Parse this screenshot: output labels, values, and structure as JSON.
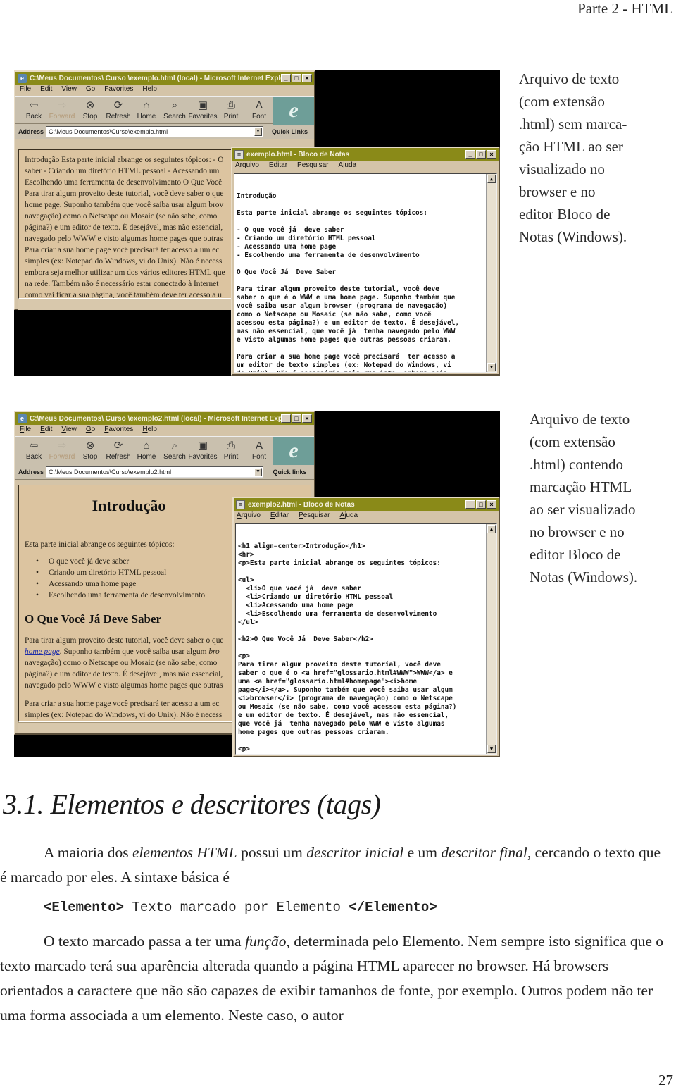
{
  "header": {
    "running_title": "Parte 2 - HTML"
  },
  "figure1": {
    "ie": {
      "title": "C:\\Meus Documentos\\ Curso \\exemplo.html (local) - Microsoft Internet Explorer",
      "menu": [
        "File",
        "Edit",
        "View",
        "Go",
        "Favorites",
        "Help"
      ],
      "toolbar": [
        {
          "label": "Back",
          "icon": "back-arrow-icon",
          "glyph": "⇦"
        },
        {
          "label": "Forward",
          "icon": "forward-arrow-icon",
          "glyph": "⇨"
        },
        {
          "label": "Stop",
          "icon": "stop-icon",
          "glyph": "⊗"
        },
        {
          "label": "Refresh",
          "icon": "refresh-icon",
          "glyph": "⟳"
        },
        {
          "label": "Home",
          "icon": "home-icon",
          "glyph": "⌂"
        },
        {
          "label": "Search",
          "icon": "search-icon",
          "glyph": "⌕"
        },
        {
          "label": "Favorites",
          "icon": "favorites-icon",
          "glyph": "▣"
        },
        {
          "label": "Print",
          "icon": "print-icon",
          "glyph": "⎙"
        },
        {
          "label": "Font",
          "icon": "font-icon",
          "glyph": "A"
        }
      ],
      "address_label": "Address",
      "address_value": "C:\\Meus Documentos\\Curso\\exemplo.html",
      "quick_links": "Quick Links",
      "content_lines": [
        "Introdução Esta parte inicial abrange os seguintes tópicos: - O",
        "saber - Criando um diretório HTML pessoal - Acessando um",
        "Escolhendo uma ferramenta de desenvolvimento O Que Você",
        "Para tirar algum proveito deste tutorial, você deve saber o que",
        "home page. Suponho também que você saiba usar algum brov",
        "navegação) como o Netscape ou Mosaic (se não sabe, como",
        "página?) e um editor de texto. É desejável, mas não essencial,",
        "navegado pelo WWW e visto algumas home pages que outras",
        "Para criar a sua home page você precisará  ter acesso a um ec",
        "simples (ex: Notepad do Windows, vi do Unix). Não é necess",
        "embora seja melhor utilizar um dos vários editores HTML que",
        "na rede. Também não é necessário estar conectado à Internet",
        "como vai ficar a sua página, você também deve ter acesso a u"
      ]
    },
    "notepad": {
      "title": "exemplo.html - Bloco de Notas",
      "menu": [
        "Arquivo",
        "Editar",
        "Pesquisar",
        "Ajuda"
      ],
      "text": "Introdução\n\nEsta parte inicial abrange os seguintes tópicos:\n\n- O que você já  deve saber\n- Criando um diretório HTML pessoal\n- Acessando uma home page\n- Escolhendo uma ferramenta de desenvolvimento\n\nO Que Você Já  Deve Saber\n\nPara tirar algum proveito deste tutorial, você deve\nsaber o que é o WWW e uma home page. Suponho também que\nvocê saiba usar algum browser (programa de navegação)\ncomo o Netscape ou Mosaic (se não sabe, como você\nacessou esta página?) e um editor de texto. É desejável,\nmas não essencial, que você já  tenha navegado pelo WWW\ne visto algumas home pages que outras pessoas criaram.\n\nPara criar a sua home page você precisará  ter acesso a\num editor de texto simples (ex: Notepad do Windows, vi\ndo Unix). Não é necessário mais que isto, embora seja\nmelhor utilizar um dos vários editores HTML que existem"
    },
    "caption": "Arquivo de texto\n(com extensão\n.html) sem marca-\nção HTML ao ser\nvisualizado no\nbrowser e no\neditor Bloco de\nNotas (Windows)."
  },
  "figure2": {
    "ie": {
      "title": "C:\\Meus Documentos\\ Curso \\exemplo2.html (local) - Microsoft Internet Explorer",
      "menu": [
        "File",
        "Edit",
        "View",
        "Go",
        "Favorites",
        "Help"
      ],
      "toolbar": [
        {
          "label": "Back",
          "icon": "back-arrow-icon",
          "glyph": "⇦"
        },
        {
          "label": "Forward",
          "icon": "forward-arrow-icon",
          "glyph": "⇨"
        },
        {
          "label": "Stop",
          "icon": "stop-icon",
          "glyph": "⊗"
        },
        {
          "label": "Refresh",
          "icon": "refresh-icon",
          "glyph": "⟳"
        },
        {
          "label": "Home",
          "icon": "home-icon",
          "glyph": "⌂"
        },
        {
          "label": "Search",
          "icon": "search-icon",
          "glyph": "⌕"
        },
        {
          "label": "Favorites",
          "icon": "favorites-icon",
          "glyph": "▣"
        },
        {
          "label": "Print",
          "icon": "print-icon",
          "glyph": "⎙"
        },
        {
          "label": "Font",
          "icon": "font-icon",
          "glyph": "A"
        }
      ],
      "address_label": "Address",
      "address_value": "C:\\Meus Documentos\\Curso\\exemplo2.html",
      "quick_links": "Quick links",
      "h1": "Introdução",
      "intro": "Esta parte inicial abrange os seguintes tópicos:",
      "list": [
        "O que você já  deve saber",
        "Criando um diretório HTML pessoal",
        "Acessando uma home page",
        "Escolhendo uma ferramenta de desenvolvimento"
      ],
      "h2": "O Que Você Já  Deve Saber",
      "p1_line1": "Para tirar algum proveito deste tutorial, você deve saber o que",
      "p1_link": "home page",
      "p1_line2_rest": ". Suponho também que você saiba usar algum ",
      "p1_line2_italic": "bro",
      "p1_rest": [
        "navegação) como o Netscape ou Mosaic (se não sabe, como",
        "página?) e um editor de texto. É desejável, mas não essencial,",
        "navegado pelo WWW e visto algumas home pages que outras"
      ],
      "p2": [
        "Para criar a sua home page você precisará  ter acesso a um ec",
        "simples (ex: Notepad do Windows, vi do Unix). Não é necess"
      ]
    },
    "notepad": {
      "title": "exemplo2.html - Bloco de Notas",
      "menu": [
        "Arquivo",
        "Editar",
        "Pesquisar",
        "Ajuda"
      ],
      "text": "<h1 align=center>Introdução</h1>\n<hr>\n<p>Esta parte inicial abrange os seguintes tópicos:\n\n<ul>\n  <li>O que você já  deve saber\n  <li>Criando um diretório HTML pessoal\n  <li>Acessando uma home page\n  <li>Escolhendo uma ferramenta de desenvolvimento\n</ul>\n\n<h2>O Que Você Já  Deve Saber</h2>\n\n<p>\nPara tirar algum proveito deste tutorial, você deve\nsaber o que é o <a href=\"glossario.html#WWW\">WWW</a> e\numa <a href=\"glossario.html#homepage\"><i>home\npage</i></a>. Suponho também que você saiba usar algum\n<i>browser</i> (programa de navegação) como o Netscape\nou Mosaic (se não sabe, como você acessou esta página?)\ne um editor de texto. É desejável, mas não essencial,\nque você já  tenha navegado pelo WWW e visto algumas\nhome pages que outras pessoas criaram.\n\n<p>\nPara criar a sua home page você precisará  ter acesso a\num editor de texto simples (ex: Notepad do Windows, vi"
    },
    "caption": "Arquivo de texto\n(com extensão\n.html) contendo\nmarcação HTML\nao ser visualizado\nno browser e no\neditor Bloco de\nNotas (Windows)."
  },
  "section": {
    "title": "3.1. Elementos e descritores (tags)",
    "p1": {
      "t1": "A maioria dos ",
      "i1": "elementos HTML",
      "t2": " possui um ",
      "i2": "descritor inicial",
      "t3": " e um ",
      "i3": "descritor final",
      "t4": ", cercando o texto que é marcado por eles. A sintaxe básica é"
    },
    "code": {
      "open": "<Elemento>",
      "middle": " Texto marcado por Elemento ",
      "close": "</Elemento>"
    },
    "p2": {
      "t1": "O texto marcado passa a ter uma ",
      "i1": "função",
      "t2": ", determinada pelo Elemento. Nem sempre isto significa que o texto marcado terá sua aparência alterada quando a página HTML aparecer no browser. Há browsers orientados a caractere que não são capazes de exibir tamanhos de fonte, por exemplo. Outros podem não ter uma forma associada a um elemento. Neste caso, o autor"
    }
  },
  "footer": {
    "page_number": "27"
  }
}
